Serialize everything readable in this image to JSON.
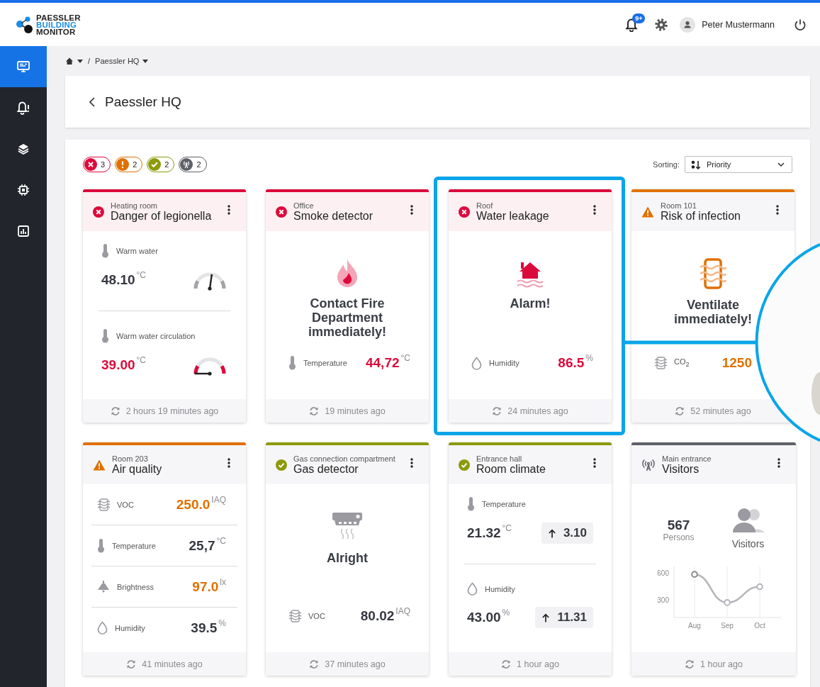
{
  "header": {
    "logo": [
      "PAESSLER",
      "BUILDING",
      "MONITOR"
    ],
    "notification_count": "9+",
    "user_name": "Peter Mustermann"
  },
  "sidebar": {
    "items": [
      {
        "selected": true
      },
      {
        "selected": false
      },
      {
        "selected": false
      },
      {
        "selected": false
      },
      {
        "selected": false
      }
    ]
  },
  "breadcrumb": {
    "separator": "/",
    "current": "Paessler HQ"
  },
  "page_title": "Paessler HQ",
  "status_filters": [
    {
      "kind": "error",
      "count": "3"
    },
    {
      "kind": "warning",
      "count": "2"
    },
    {
      "kind": "ok",
      "count": "2"
    },
    {
      "kind": "inactive",
      "count": "2"
    }
  ],
  "sorting": {
    "label": "Sorting:",
    "value": "Priority"
  },
  "cards": [
    {
      "status": {
        "kind": "error"
      },
      "location": "Heating room",
      "title": "Danger of legionella",
      "kind": "gauges",
      "highlighted": false,
      "updated": "2 hours 19 minutes ago",
      "metrics": [
        {
          "kind": "temperature",
          "label": "Warm water",
          "value": "48.10",
          "unit": "°C",
          "color": "#35383f",
          "alarm": false,
          "level": 0.56
        },
        {
          "kind": "temperature",
          "label": "Warm water circulation",
          "value": "39.00",
          "unit": "°C",
          "color": "#dc0a3c",
          "alarm": true,
          "level": 0.05
        }
      ]
    },
    {
      "status": {
        "kind": "error"
      },
      "location": "Office",
      "title": "Smoke detector",
      "kind": "message",
      "illustration": {
        "kind": "fire"
      },
      "message": "Contact Fire Department immediately!",
      "highlighted": false,
      "updated": "19 minutes ago",
      "metrics": [
        {
          "kind": "temperature",
          "label": "Temperature",
          "value": "44,72",
          "unit": "°C",
          "color": "#dc0a3c"
        }
      ]
    },
    {
      "status": {
        "kind": "error"
      },
      "location": "Roof",
      "title": "Water leakage",
      "kind": "message",
      "illustration": {
        "kind": "water"
      },
      "message": "Alarm!",
      "highlighted": true,
      "updated": "24 minutes ago",
      "metrics": [
        {
          "kind": "humidity",
          "label": "Humidity",
          "value": "86.5",
          "unit": "%",
          "color": "#dc0a3c"
        }
      ]
    },
    {
      "status": {
        "kind": "warning"
      },
      "location": "Room 101",
      "title": "Risk of infection",
      "kind": "message",
      "illustration": {
        "kind": "air"
      },
      "message": "Ventilate immediately!",
      "highlighted": false,
      "updated": "52 minutes ago",
      "metrics": [
        {
          "kind": "co2",
          "label": "CO$_{2}$",
          "value": "1250",
          "color": "#e07000"
        }
      ]
    },
    {
      "status": {
        "kind": "warning"
      },
      "location": "Room 203",
      "title": "Air quality",
      "kind": "list",
      "highlighted": false,
      "updated": "41 minutes ago",
      "metrics": [
        {
          "kind": "voc",
          "label": "VOC",
          "value": "250.0",
          "unit": "IAQ",
          "color": "#e07000"
        },
        {
          "kind": "temperature",
          "label": "Temperature",
          "value": "25,7",
          "unit": "°C",
          "color": "#35383f"
        },
        {
          "kind": "brightness",
          "label": "Brightness",
          "value": "97.0",
          "unit": "lx",
          "color": "#e07000"
        },
        {
          "kind": "humidity",
          "label": "Humidity",
          "value": "39.5",
          "unit": "%",
          "color": "#35383f"
        }
      ]
    },
    {
      "status": {
        "kind": "ok"
      },
      "location": "Gas connection compartment",
      "title": "Gas detector",
      "kind": "message",
      "illustration": {
        "kind": "gas"
      },
      "message": "Alright",
      "highlighted": false,
      "updated": "37 minutes ago",
      "metrics": [
        {
          "kind": "voc",
          "label": "VOC",
          "value": "80.02",
          "unit": "IAQ",
          "color": "#35383f"
        }
      ]
    },
    {
      "status": {
        "kind": "ok"
      },
      "location": "Entrance hall",
      "title": "Room climate",
      "kind": "trend",
      "highlighted": false,
      "updated": "1 hour ago",
      "metrics": [
        {
          "kind": "temperature",
          "label": "Temperature",
          "value": "21.32",
          "unit": "°C",
          "color": "#35383f",
          "change": "3.10"
        },
        {
          "kind": "humidity",
          "label": "Humidity",
          "value": "43.00",
          "unit": "%",
          "color": "#35383f",
          "change": "11.31"
        }
      ]
    },
    {
      "status": {
        "kind": "inactive"
      },
      "location": "Main entrance",
      "title": "Visitors",
      "kind": "visitors",
      "highlighted": false,
      "updated": "1 hour ago",
      "count": "567",
      "count_label": "Persons",
      "caption": "Visitors",
      "chart_data": {
        "type": "line",
        "categories": [
          "Aug",
          "Sep",
          "Oct"
        ],
        "series": [
          {
            "color": "#b4b4b9",
            "marker": "circle",
            "values": [
              590,
              270,
              450
            ]
          }
        ],
        "ylim": [
          100,
          680
        ],
        "yticks": [
          300,
          600
        ],
        "grid": true
      }
    }
  ]
}
